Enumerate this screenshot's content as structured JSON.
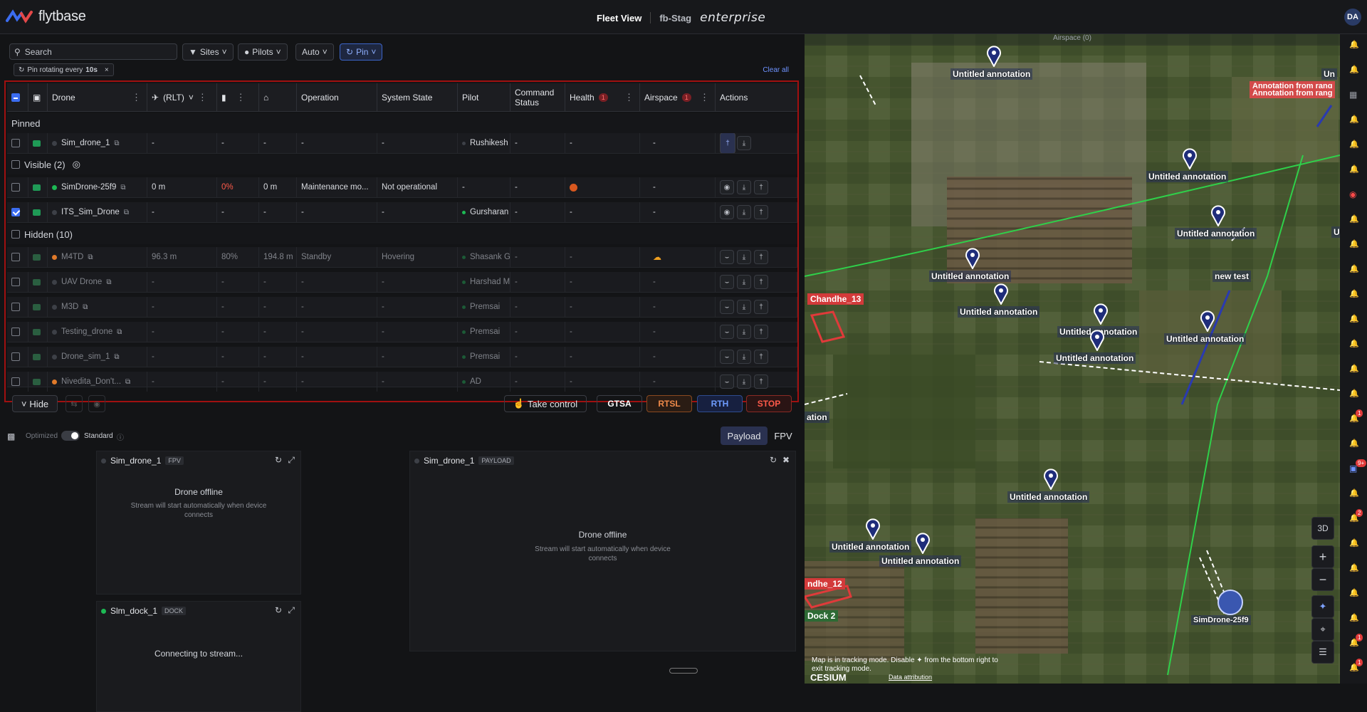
{
  "app": {
    "logo_text": "flytbase",
    "view": "Fleet View",
    "org": "fb-Stag",
    "plan": "enterprise",
    "avatar": "DA"
  },
  "filters": {
    "search_placeholder": "Search",
    "sites": "Sites",
    "pilots": "Pilots",
    "auto": "Auto",
    "pin": "Pin",
    "chip_text": "Pin rotating every",
    "chip_value": "10s",
    "clear_all": "Clear all"
  },
  "columns": {
    "drone": "Drone",
    "rlt": "(RLT)",
    "operation": "Operation",
    "system_state": "System State",
    "pilot": "Pilot",
    "command_status_1": "Command",
    "command_status_2": "Status",
    "health": "Health",
    "health_badge": "1",
    "airspace": "Airspace",
    "airspace_badge": "1",
    "actions": "Actions"
  },
  "groups": {
    "pinned": "Pinned",
    "visible": "Visible (2)",
    "hidden": "Hidden (10)"
  },
  "rows": [
    {
      "name": "Sim_drone_1",
      "rlt": "-",
      "battery": "-",
      "home": "-",
      "operation": "-",
      "state": "-",
      "pilot": "Rushikesh",
      "cmd": "-",
      "health": "-",
      "airspace": "-"
    },
    {
      "name": "SimDrone-25f9",
      "rlt": "0 m",
      "battery": "0%",
      "home": "0 m",
      "operation": "Maintenance mo...",
      "state": "Not operational",
      "pilot": "-",
      "cmd": "-",
      "health": "",
      "airspace": "-"
    },
    {
      "name": "ITS_Sim_Drone",
      "rlt": "-",
      "battery": "-",
      "home": "-",
      "operation": "-",
      "state": "-",
      "pilot": "Gursharan",
      "cmd": "-",
      "health": "-",
      "airspace": "-"
    },
    {
      "name": "M4TD",
      "rlt": "96.3 m",
      "battery": "80%",
      "home": "194.8 m",
      "operation": "Standby",
      "state": "Hovering",
      "pilot": "Shasank G",
      "cmd": "-",
      "health": "-",
      "airspace": ""
    },
    {
      "name": "UAV Drone",
      "rlt": "-",
      "battery": "-",
      "home": "-",
      "operation": "-",
      "state": "-",
      "pilot": "Harshad M",
      "cmd": "-",
      "health": "-",
      "airspace": "-"
    },
    {
      "name": "M3D",
      "rlt": "-",
      "battery": "-",
      "home": "-",
      "operation": "-",
      "state": "-",
      "pilot": "Premsai",
      "cmd": "-",
      "health": "-",
      "airspace": "-"
    },
    {
      "name": "Testing_drone",
      "rlt": "-",
      "battery": "-",
      "home": "-",
      "operation": "-",
      "state": "-",
      "pilot": "Premsai",
      "cmd": "-",
      "health": "-",
      "airspace": "-"
    },
    {
      "name": "Drone_sim_1",
      "rlt": "-",
      "battery": "-",
      "home": "-",
      "operation": "-",
      "state": "-",
      "pilot": "Premsai",
      "cmd": "-",
      "health": "-",
      "airspace": "-"
    },
    {
      "name": "Nivedita_Don't...",
      "rlt": "-",
      "battery": "-",
      "home": "-",
      "operation": "-",
      "state": "-",
      "pilot": "AD",
      "cmd": "-",
      "health": "-",
      "airspace": "-"
    }
  ],
  "controls": {
    "hide": "Hide",
    "take_control": "Take control",
    "gtsa": "GTSA",
    "rtsl": "RTSL",
    "rth": "RTH",
    "stop": "STOP"
  },
  "stream": {
    "optimized": "Optimized",
    "standard": "Standard",
    "payload": "Payload",
    "fpv": "FPV"
  },
  "panels": {
    "p1_title": "Sim_drone_1",
    "p1_tag": "FPV",
    "p1_msg": "Drone offline",
    "p1_sub": "Stream will start automatically when device connects",
    "p2_title": "Sim_drone_1",
    "p2_tag": "PAYLOAD",
    "p2_msg": "Drone offline",
    "p2_sub": "Stream will start automatically when device connects",
    "p3_title": "Slm_dock_1",
    "p3_tag": "DOCK",
    "p3_msg": "Connecting to stream..."
  },
  "map": {
    "airspace": "Airspace (0)",
    "annotations": [
      "Untitled annotation",
      "Untitled annotation",
      "Untitled annotation",
      "Untitled annotation",
      "Untitled annotation",
      "Untitled annotation",
      "Untitled annotation",
      "Untitled annotation",
      "Untitled annotation",
      "Untitled annotation",
      "Untitled annotation"
    ],
    "new_test": "new test",
    "chandhe_13": "Chandhe_13",
    "chandhe_12": "ndhe_12",
    "dock2": "Dock 2",
    "ation": "ation",
    "annot_range": "Annotation from rang",
    "annot_range2": "Annotation from rang",
    "un": "Un",
    "u": "U",
    "drone_label": "SimDrone-25f9",
    "btn_3d": "3D",
    "tracking_line1": "Map is in tracking mode. Disable",
    "tracking_line2": "from the bottom right to",
    "tracking_line3": "exit tracking mode.",
    "cesium": "CESIUM",
    "attribution": "Data attribution"
  },
  "notifications": {
    "badge1": "1",
    "badge2": "9+",
    "badge3": "2",
    "badge4": "1",
    "badge5": "1"
  }
}
